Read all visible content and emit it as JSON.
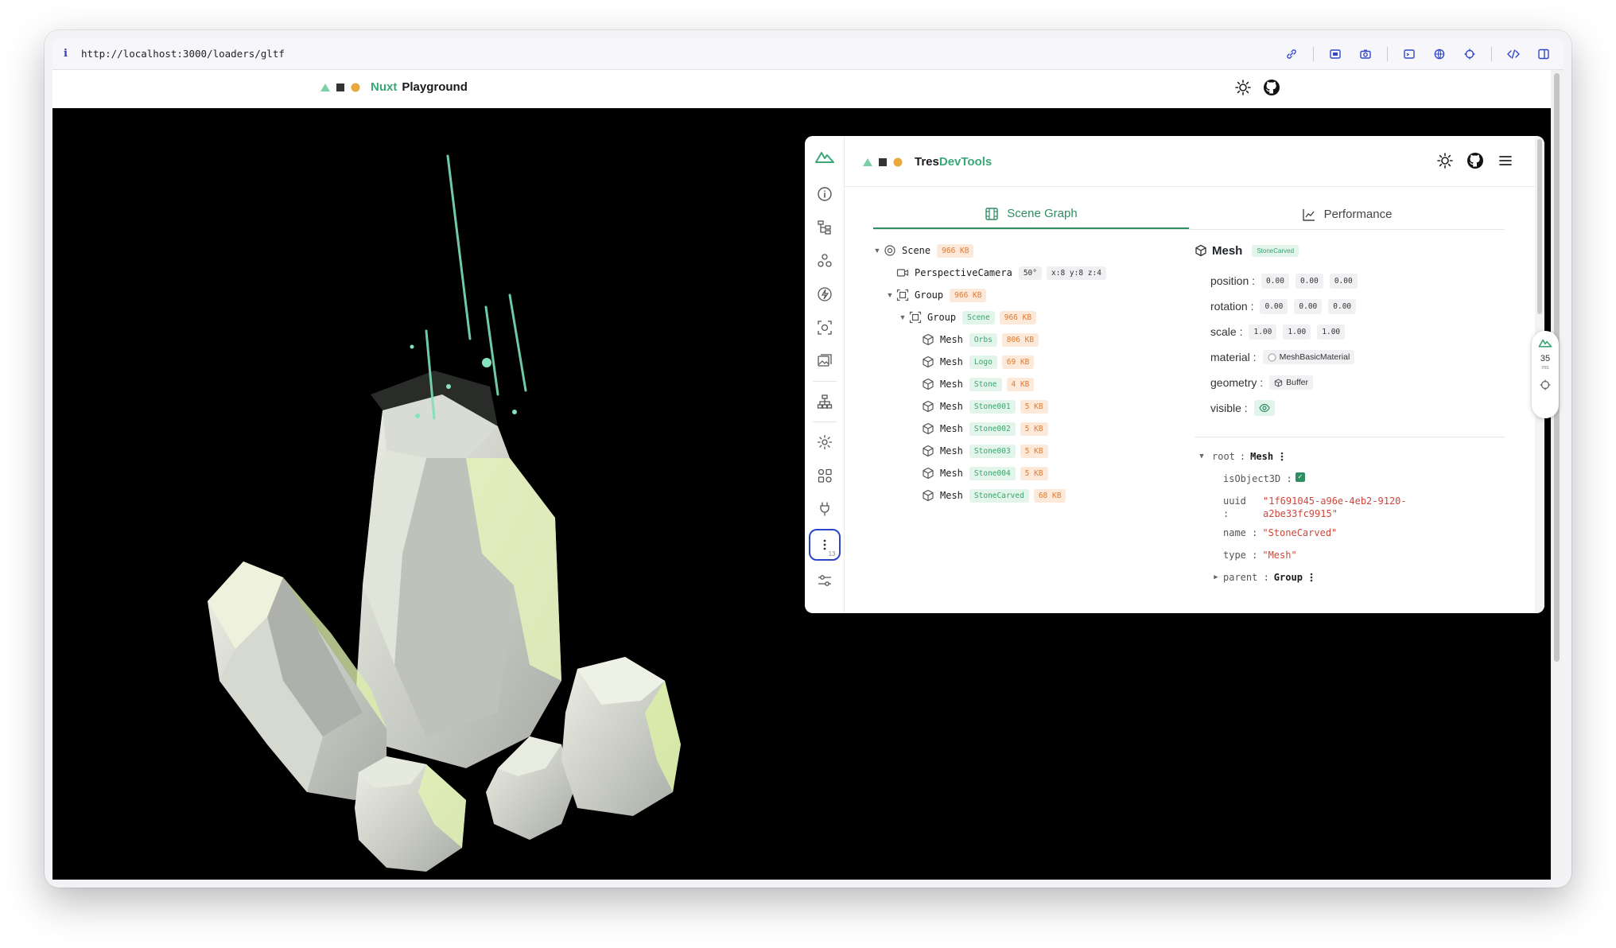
{
  "browser": {
    "info_glyph": "i",
    "url": "http://localhost:3000/loaders/gltf"
  },
  "header": {
    "brand_nuxt": "Nuxt",
    "brand_playground": "Playground"
  },
  "devtools": {
    "brand_tres": "Tres",
    "brand_devtools": "DevTools",
    "tabs": [
      {
        "label": "Scene Graph",
        "active": true
      },
      {
        "label": "Performance",
        "active": false
      }
    ],
    "more_badge": "13",
    "tree": [
      {
        "name": "Scene",
        "chips": [
          {
            "text": "966 KB",
            "kind": "orange"
          }
        ],
        "expanded": true
      },
      {
        "name": "PerspectiveCamera",
        "chips": [
          {
            "text": "50°",
            "kind": "gray"
          },
          {
            "text": "x:8 y:8 z:4",
            "kind": "gray"
          }
        ]
      },
      {
        "name": "Group",
        "chips": [
          {
            "text": "966 KB",
            "kind": "orange"
          }
        ],
        "expanded": true
      },
      {
        "name": "Group",
        "chips": [
          {
            "text": "Scene",
            "kind": "green"
          },
          {
            "text": "966 KB",
            "kind": "orange"
          }
        ],
        "expanded": true
      },
      {
        "name": "Mesh",
        "chips": [
          {
            "text": "Orbs",
            "kind": "green"
          },
          {
            "text": "806 KB",
            "kind": "orange"
          }
        ]
      },
      {
        "name": "Mesh",
        "chips": [
          {
            "text": "Logo",
            "kind": "green"
          },
          {
            "text": "69 KB",
            "kind": "orange"
          }
        ]
      },
      {
        "name": "Mesh",
        "chips": [
          {
            "text": "Stone",
            "kind": "green"
          },
          {
            "text": "4 KB",
            "kind": "orange"
          }
        ]
      },
      {
        "name": "Mesh",
        "chips": [
          {
            "text": "Stone001",
            "kind": "green"
          },
          {
            "text": "5 KB",
            "kind": "orange"
          }
        ]
      },
      {
        "name": "Mesh",
        "chips": [
          {
            "text": "Stone002",
            "kind": "green"
          },
          {
            "text": "5 KB",
            "kind": "orange"
          }
        ]
      },
      {
        "name": "Mesh",
        "chips": [
          {
            "text": "Stone003",
            "kind": "green"
          },
          {
            "text": "5 KB",
            "kind": "orange"
          }
        ]
      },
      {
        "name": "Mesh",
        "chips": [
          {
            "text": "Stone004",
            "kind": "green"
          },
          {
            "text": "5 KB",
            "kind": "orange"
          }
        ]
      },
      {
        "name": "Mesh",
        "chips": [
          {
            "text": "StoneCarved",
            "kind": "green"
          },
          {
            "text": "68 KB",
            "kind": "orange"
          }
        ]
      }
    ],
    "props": {
      "title": "Mesh",
      "title_chip": "StoneCarved",
      "position_label": "position :",
      "position": [
        "0.00",
        "0.00",
        "0.00"
      ],
      "rotation_label": "rotation :",
      "rotation": [
        "0.00",
        "0.00",
        "0.00"
      ],
      "scale_label": "scale :",
      "scale": [
        "1.00",
        "1.00",
        "1.00"
      ],
      "material_label": "material :",
      "material": "MeshBasicMaterial",
      "geometry_label": "geometry :",
      "geometry": "Buffer",
      "visible_label": "visible :"
    },
    "object": {
      "root_key": "root",
      "root_sep": ":",
      "root_val": "Mesh",
      "isObject3D_key": "isObject3D :",
      "uuid_key": "uuid",
      "uuid_colon": ":",
      "uuid_line1": "\"1f691045-a96e-4eb2-9120-",
      "uuid_line2": "a2be33fc9915\"",
      "name_key": "name :",
      "name_val": "\"StoneCarved\"",
      "type_key": "type :",
      "type_val": "\"Mesh\"",
      "parent_key": "parent :",
      "parent_val": "Group"
    }
  },
  "fps": {
    "value": "35",
    "unit": "ms"
  },
  "colors": {
    "accent": "#2f8f62",
    "nuxt_green": "#3aa876",
    "chip_orange": "#e07a2e"
  }
}
